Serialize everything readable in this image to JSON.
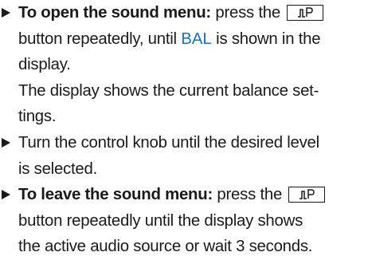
{
  "steps": [
    {
      "lead": "To open the sound menu:",
      "l1_after_lead": " press the",
      "button_icon": "sound-icon",
      "l2_a": "button repeatedly, until ",
      "display_value": "BAL",
      "l2_b": " is shown in the",
      "l3": "display.",
      "l4": "The display shows the current balance set-",
      "l5": "tings."
    },
    {
      "l1": "Turn the control knob until the desired level",
      "l2": "is selected."
    },
    {
      "lead": "To leave the sound menu:",
      "l1_after_lead": " press the",
      "button_icon": "sound-icon",
      "l2": "button repeatedly until the display shows",
      "l3": "the active audio source or wait 3 seconds."
    }
  ]
}
